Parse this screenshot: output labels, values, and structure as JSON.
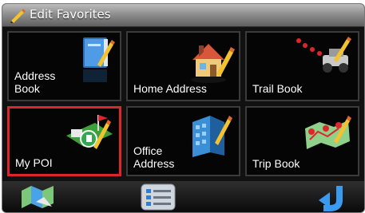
{
  "window": {
    "title": "Edit Favorites",
    "title_icon": "pencil-icon"
  },
  "tiles": [
    {
      "label": "Address\nBook",
      "icon": "address-book-icon"
    },
    {
      "label": "Home Address",
      "icon": "home-icon"
    },
    {
      "label": "Trail Book",
      "icon": "trail-jeep-icon"
    },
    {
      "label": "My POI",
      "icon": "poi-golf-icon",
      "selected": true
    },
    {
      "label": "Office\nAddress",
      "icon": "office-building-icon"
    },
    {
      "label": "Trip Book",
      "icon": "trip-map-icon"
    }
  ],
  "bottom_bar": {
    "left_icon": "map-icon",
    "center_icon": "list-menu-icon",
    "right_icon": "back-arrow-icon"
  },
  "colors": {
    "selection": "#e0252a",
    "accent_blue": "#2b7fd6"
  }
}
